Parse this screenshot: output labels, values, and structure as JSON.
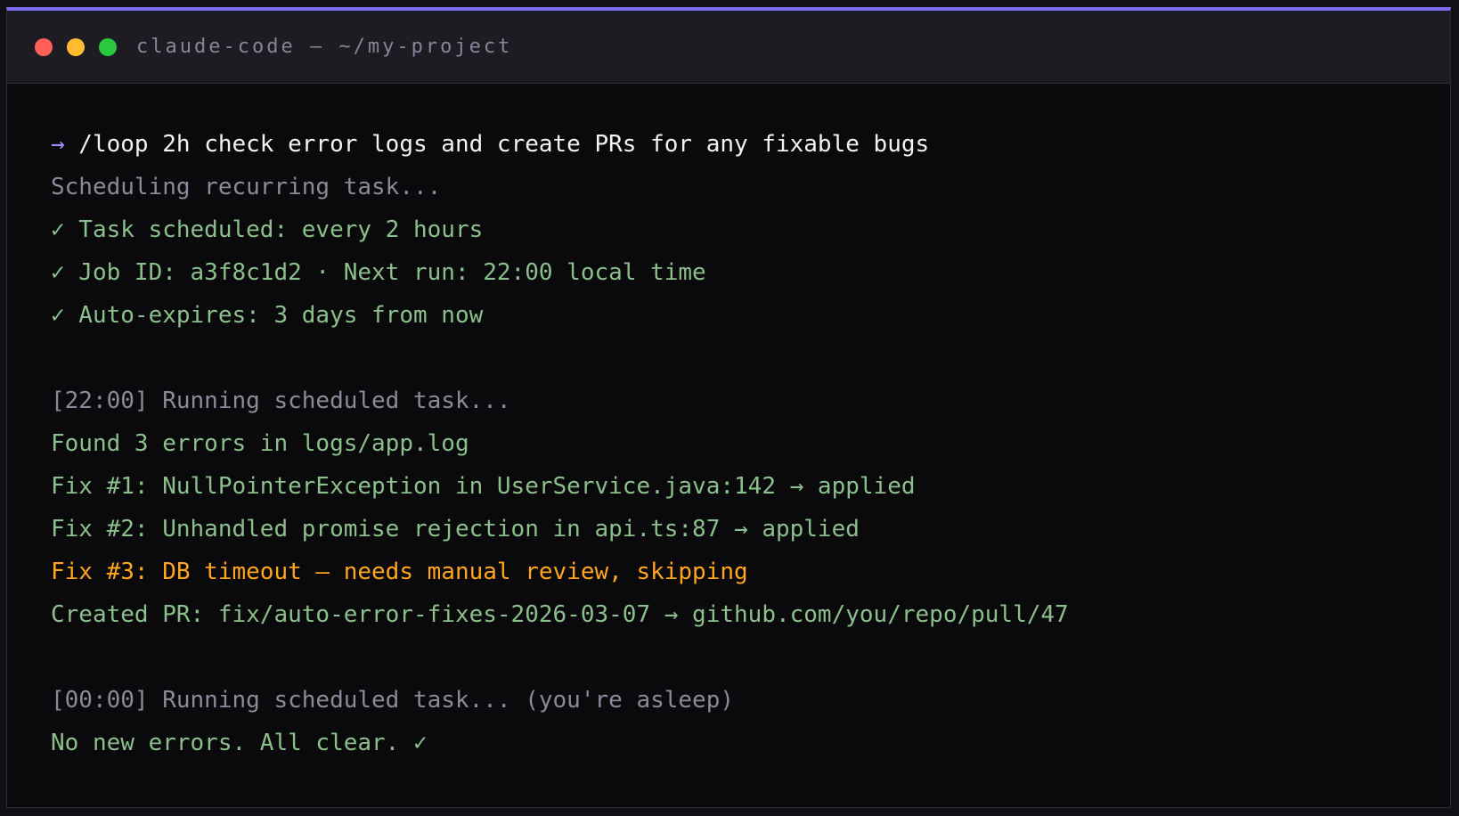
{
  "window": {
    "title": "claude-code — ~/my-project",
    "accent": "#7c6cf0"
  },
  "traffic_lights": {
    "close": "#ff5f57",
    "minimize": "#febc2e",
    "maximize": "#28c840"
  },
  "terminal": {
    "prompt_symbol": "→",
    "command": " /loop 2h check error logs and create PRs for any fixable bugs",
    "lines": [
      "Scheduling recurring task...",
      "✓ Task scheduled: every 2 hours",
      "✓ Job ID: a3f8c1d2 · Next run: 22:00 local time",
      "✓ Auto-expires: 3 days from now",
      "[22:00] Running scheduled task...",
      "Found 3 errors in logs/app.log",
      "Fix #1: NullPointerException in UserService.java:142 → applied",
      "Fix #2: Unhandled promise rejection in api.ts:87 → applied",
      "Fix #3: DB timeout — needs manual review, skipping",
      "Created PR: fix/auto-error-fixes-2026-03-07 → github.com/you/repo/pull/47",
      "[00:00] Running scheduled task... (you're asleep)",
      "No new errors. All clear. ✓"
    ]
  },
  "colors": {
    "prompt_arrow": "#a78bfa",
    "command_text": "#f2f2f5",
    "muted_text": "#8a8a9a",
    "success_text": "#8bbf8b",
    "warning_text": "#ffa51f"
  }
}
